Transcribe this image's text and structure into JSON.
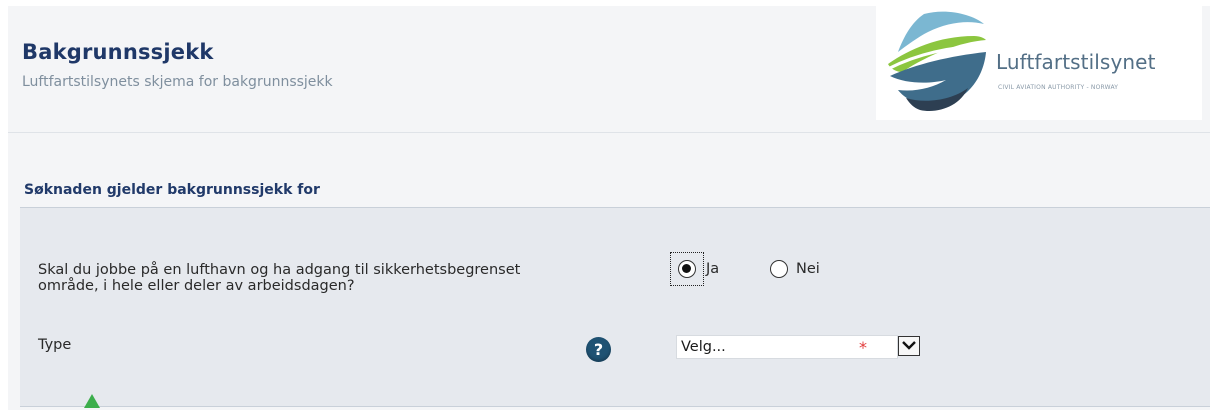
{
  "header": {
    "title": "Bakgrunnssjekk",
    "subtitle": "Luftfartstilsynets skjema for bakgrunnssjekk"
  },
  "logo": {
    "name": "Luftfartstilsynet",
    "tagline": "CIVIL AVIATION AUTHORITY - NORWAY",
    "colors": [
      "#6aa9c8",
      "#8cc63f",
      "#3e6f8c",
      "#2c3e50"
    ]
  },
  "section": {
    "title": "Søknaden gjelder bakgrunnssjekk for"
  },
  "form": {
    "question": "Skal du jobbe på en lufthavn og ha adgang til sikkerhetsbegrenset område, i hele eller deler av arbeidsdagen?",
    "options": {
      "ja": "Ja",
      "nei": "Nei",
      "selected": "Ja"
    },
    "type_label": "Type",
    "help_icon": "?",
    "select_value": "Velg...",
    "required_mark": "*"
  },
  "colors": {
    "title": "#1f3868",
    "panel": "#e6e9ee",
    "help": "#1f5273",
    "required": "#e23b3b",
    "cursor": "#3cae4c"
  }
}
